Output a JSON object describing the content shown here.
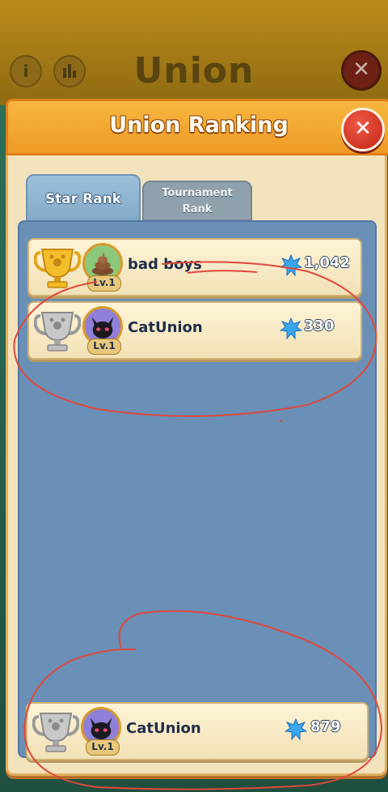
{
  "background": {
    "title": "Union",
    "info_label": "i"
  },
  "modal": {
    "title": "Union Ranking",
    "close_label": "✕"
  },
  "tabs": [
    {
      "label": "Star Rank",
      "active": true
    },
    {
      "label_line1": "Tournament",
      "label_line2": "Rank",
      "active": false
    }
  ],
  "rankings": [
    {
      "name": "bad boys",
      "level": "Lv.1",
      "score": "1,042",
      "trophy": "gold-trophy-icon",
      "avatar": "poop-icon"
    },
    {
      "name": "CatUnion",
      "level": "Lv.1",
      "score": "330",
      "trophy": "silver-trophy-icon",
      "avatar": "black-cat-icon"
    }
  ],
  "own_entry": {
    "name": "CatUnion",
    "level": "Lv.1",
    "score": "879",
    "trophy": "silver-trophy-icon",
    "avatar": "black-cat-icon"
  },
  "colors": {
    "header_orange": "#ee9b26",
    "panel_blue": "#6a90b8",
    "row_cream": "#f8ebc6",
    "annotation_red": "#e0483a"
  }
}
